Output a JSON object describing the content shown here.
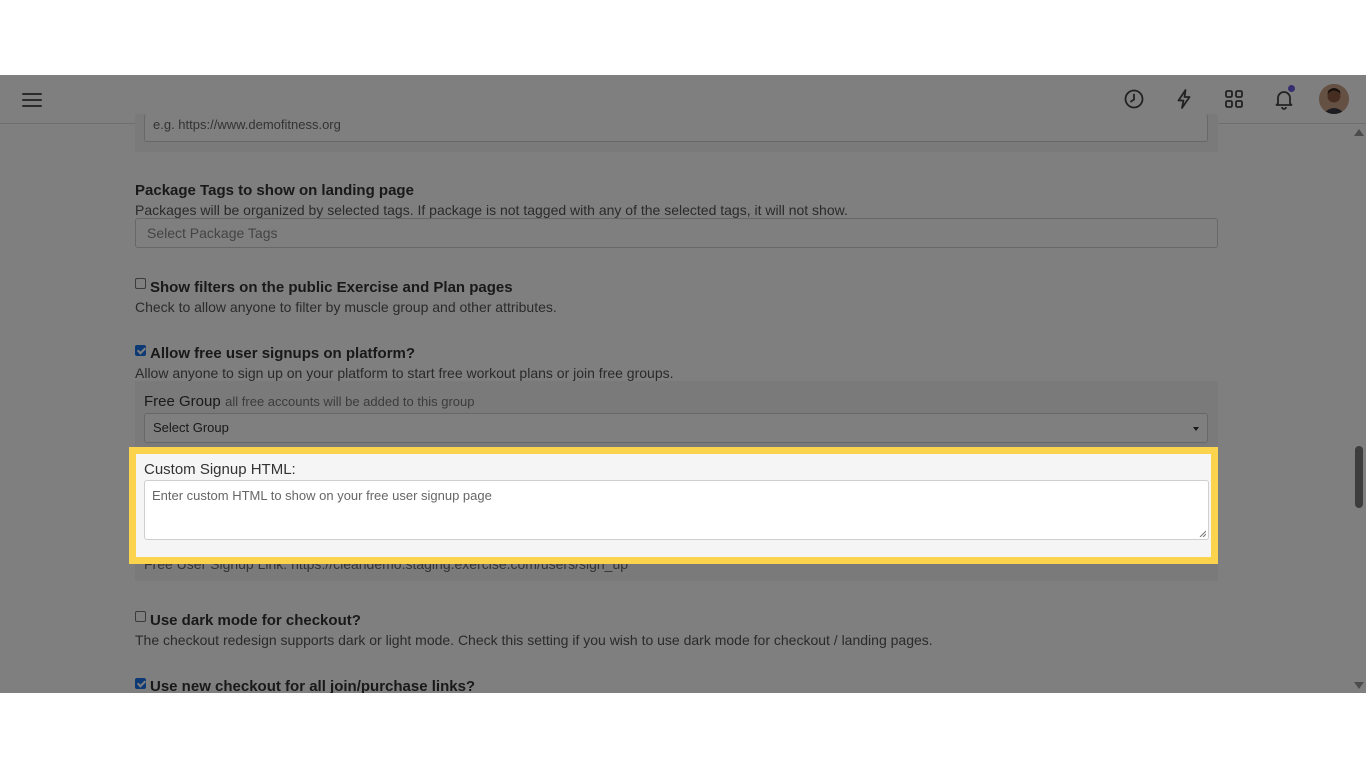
{
  "header": {
    "icons": [
      "menu-icon",
      "history-icon",
      "lightning-icon",
      "apps-grid-icon",
      "bell-icon",
      "avatar"
    ],
    "notification_dot_color": "#6a5ae0"
  },
  "website_field": {
    "placeholder": "e.g. https://www.demofitness.org"
  },
  "package_tags": {
    "title": "Package Tags to show on landing page",
    "help": "Packages will be organized by selected tags. If package is not tagged with any of the selected tags, it will not show.",
    "placeholder": "Select Package Tags"
  },
  "show_filters": {
    "checked": false,
    "title": "Show filters on the public Exercise and Plan pages",
    "help": "Check to allow anyone to filter by muscle group and other attributes."
  },
  "free_signups": {
    "checked": true,
    "title": "Allow free user signups on platform?",
    "help": "Allow anyone to sign up on your platform to start free workout plans or join free groups.",
    "free_group_label": "Free Group",
    "free_group_help": "all free accounts will be added to this group",
    "free_group_selected": "Select Group",
    "custom_html_label": "Custom Signup HTML:",
    "custom_html_placeholder": "Enter custom HTML to show on your free user signup page",
    "signup_link_text": "Free User Signup Link: https://cleandemo.staging.exercise.com/users/sign_up"
  },
  "dark_mode": {
    "checked": false,
    "title": "Use dark mode for checkout?",
    "help": "The checkout redesign supports dark or light mode. Check this setting if you wish to use dark mode for checkout / landing pages."
  },
  "new_checkout": {
    "checked": true,
    "title": "Use new checkout for all join/purchase links?"
  },
  "colors": {
    "highlight": "#fcd34d",
    "checkbox_accent": "#1a73e8"
  }
}
